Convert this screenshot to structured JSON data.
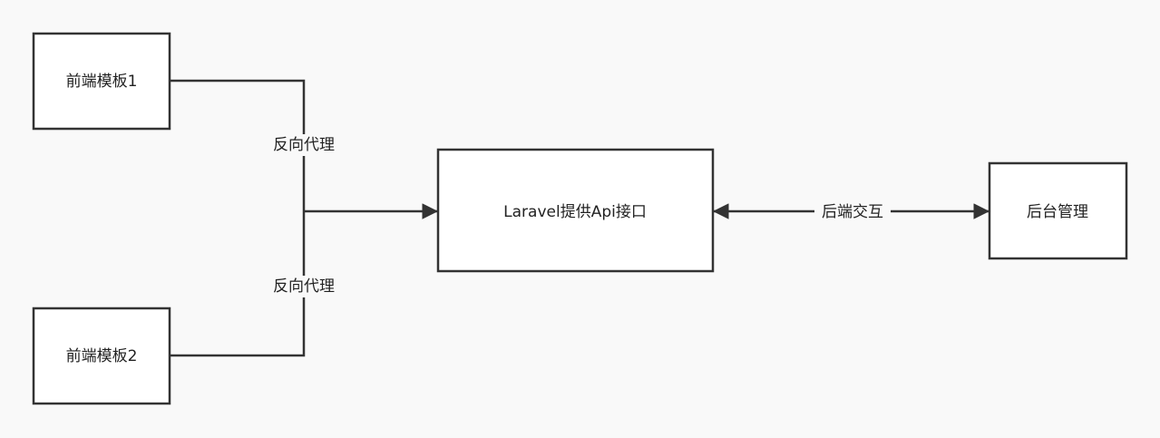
{
  "colors": {
    "background": "#f9f9f9",
    "stroke": "#333333",
    "node_fill": "#ffffff",
    "text": "#222222"
  },
  "nodes": {
    "template1": "前端模板1",
    "template2": "前端模板2",
    "api": "Laravel提供Api接口",
    "admin": "后台管理"
  },
  "edges": {
    "proxy_top": "反向代理",
    "proxy_bottom": "反向代理",
    "backend": "后端交互"
  }
}
